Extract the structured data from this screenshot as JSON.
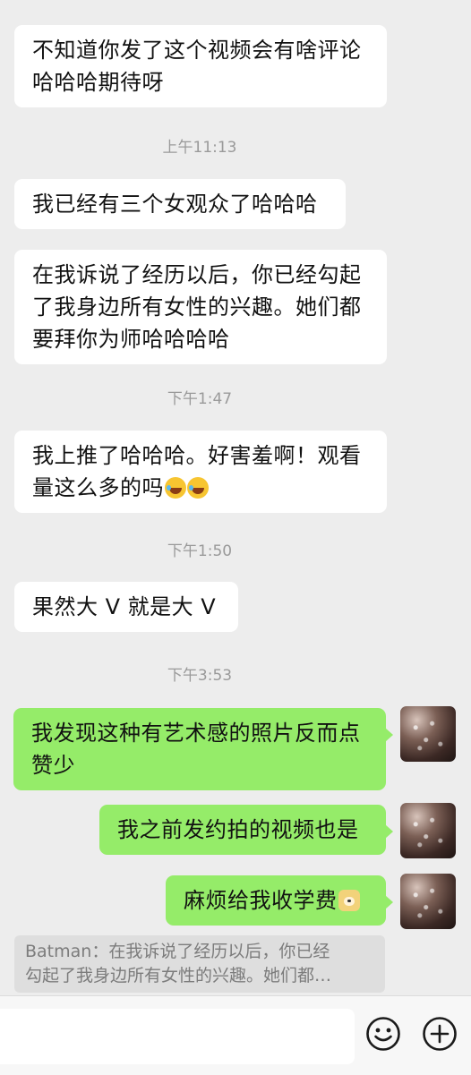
{
  "messages": [
    {
      "side": "in",
      "text_lines": [
        "不知道你发了这个视频会有啥评论",
        "哈哈哈期待呀"
      ]
    },
    {
      "timestamp": "上午11:13"
    },
    {
      "side": "in",
      "text_lines": [
        "我已经有三个女观众了哈哈哈"
      ]
    },
    {
      "side": "in",
      "text_lines": [
        "在我诉说了经历以后，你已经勾起",
        "了我身边所有女性的兴趣。她们都",
        "要拜你为师哈哈哈哈"
      ]
    },
    {
      "timestamp": "下午1:47"
    },
    {
      "side": "in",
      "text_lines": [
        "我上推了哈哈哈。好害羞啊！观看",
        "量这么多的吗"
      ],
      "emojis": [
        "laughing-crying",
        "laughing-crying"
      ]
    },
    {
      "timestamp": "下午1:50"
    },
    {
      "side": "in",
      "text_lines": [
        "果然大 V 就是大 V"
      ]
    },
    {
      "timestamp": "下午3:53"
    },
    {
      "side": "out",
      "text_lines": [
        "我发现这种有艺术感的照片反而点",
        "赞少"
      ]
    },
    {
      "side": "out",
      "text_lines": [
        "我之前发约拍的视频也是"
      ]
    },
    {
      "side": "out",
      "text_lines": [
        "麻烦给我收学费"
      ],
      "emojis": [
        "doge"
      ]
    }
  ],
  "quote": {
    "line1": "Batman：在我诉说了经历以后，你已经",
    "line2": "勾起了我身边所有女性的兴趣。她们都…"
  },
  "input": {
    "value": ""
  },
  "icons": {
    "emoji_button": "smiley-icon",
    "plus_button": "plus-circle-icon"
  },
  "colors": {
    "background": "#ededed",
    "incoming_bubble": "#ffffff",
    "outgoing_bubble": "#95ec69",
    "timestamp": "#9a9a9a"
  }
}
